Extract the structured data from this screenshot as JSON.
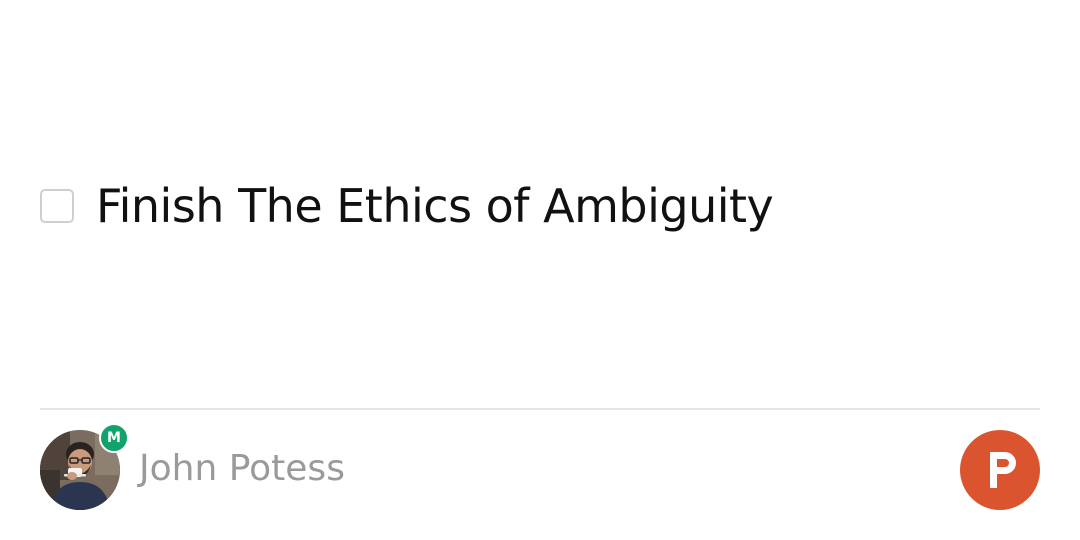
{
  "task": {
    "title": "Finish The Ethics of Ambiguity",
    "completed": false
  },
  "footer": {
    "user": {
      "name": "John Potess",
      "badge_letter": "M",
      "badge_color": "#12a36d"
    },
    "logo": {
      "letter": "P",
      "color": "#da552f"
    }
  }
}
